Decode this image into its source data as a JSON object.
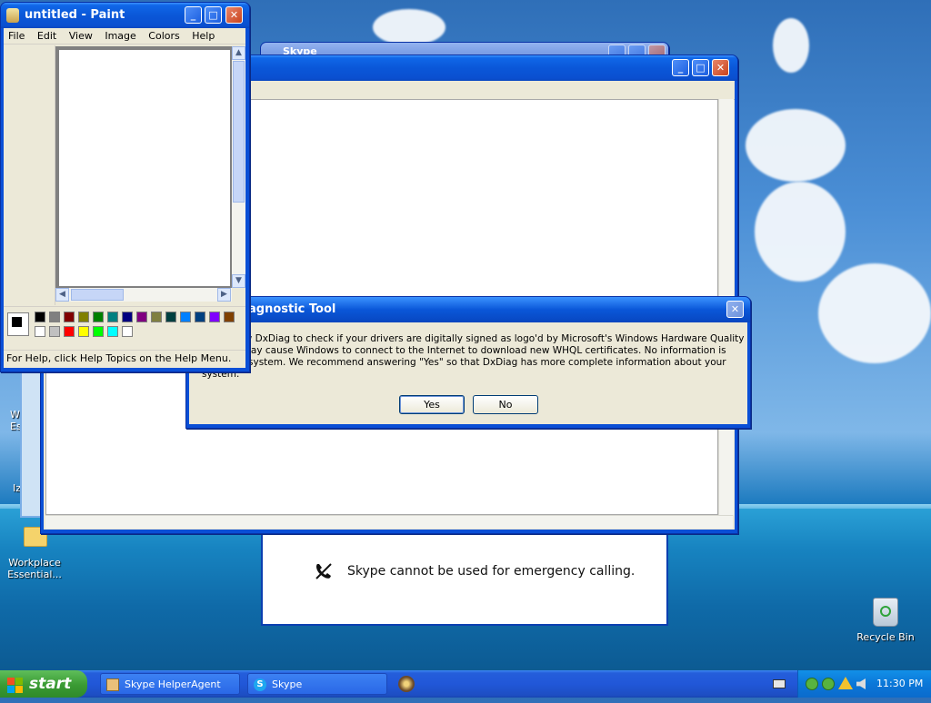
{
  "paint": {
    "title": "untitled - Paint",
    "menu": [
      "File",
      "Edit",
      "View",
      "Image",
      "Colors",
      "Help"
    ],
    "status": "For Help, click Help Topics on the Help Menu.",
    "palette_top": [
      "#000000",
      "#808080",
      "#800000",
      "#808000",
      "#008000",
      "#008080",
      "#000080",
      "#800080",
      "#808040",
      "#004040",
      "#0080ff",
      "#004080",
      "#8000ff",
      "#804000"
    ],
    "palette_bottom": [
      "#ffffff",
      "#c0c0c0",
      "#ff0000",
      "#ffff00",
      "#00ff00",
      "#00ffff",
      "#ffffff"
    ]
  },
  "dialog": {
    "title": "agnostic Tool",
    "message_line1": "nt to allow DxDiag to check if your drivers are digitally signed as logo'd by Microsoft's Windows Hardware Quality",
    "message_line2": "L)?  This may cause Windows to connect to the Internet to download new WHQL certificates.  No information is",
    "message_line3": "rom your system.  We recommend answering \"Yes\" so that DxDiag has more complete information about your",
    "message_line4": "system.",
    "yes_label": "Yes",
    "no_label": "No"
  },
  "skype_back": {
    "title": "Skype"
  },
  "skype_notice": {
    "text": "Skype cannot be used for emergency calling."
  },
  "desktop": {
    "icons": [
      {
        "label_line1": "Wo",
        "label_line2": "Es"
      },
      {
        "label_line1": "Iz",
        "label_line2": ""
      },
      {
        "label_line1": "Workplace",
        "label_line2": "Essential..."
      },
      {
        "label_line1": "Recycle Bin",
        "label_line2": ""
      }
    ]
  },
  "taskbar": {
    "start_label": "start",
    "items": [
      "Skype HelperAgent",
      "Skype"
    ],
    "clock": "11:30 PM"
  }
}
